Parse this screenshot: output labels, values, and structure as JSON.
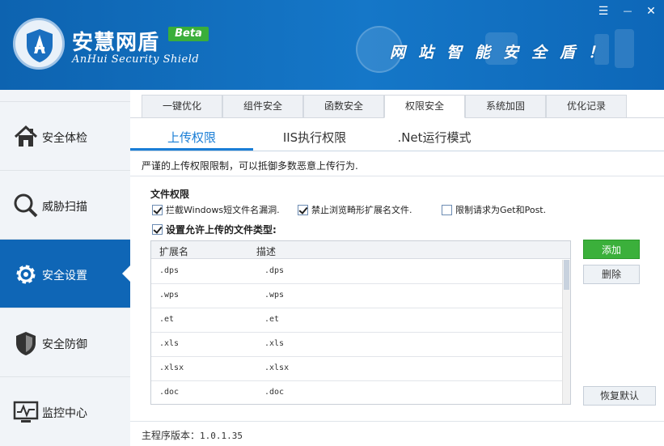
{
  "app": {
    "title": "安慧网盾",
    "badge": "Beta",
    "subtitle": "AnHui Security Shield",
    "slogan": "网站智能安全盾！",
    "brand_color": "#1571c2"
  },
  "window_controls": {
    "menu": "☰",
    "minimize": "—",
    "close": "✕"
  },
  "sidebar": {
    "items": [
      {
        "label": "安全体检",
        "icon": "home-icon"
      },
      {
        "label": "威胁扫描",
        "icon": "magnifier-icon"
      },
      {
        "label": "安全设置",
        "icon": "gear-icon",
        "active": true
      },
      {
        "label": "安全防御",
        "icon": "shield-icon"
      },
      {
        "label": "监控中心",
        "icon": "monitor-icon"
      }
    ]
  },
  "tabs": [
    {
      "label": "一键优化"
    },
    {
      "label": "组件安全"
    },
    {
      "label": "函数安全"
    },
    {
      "label": "权限安全",
      "active": true
    },
    {
      "label": "系统加固"
    },
    {
      "label": "优化记录"
    }
  ],
  "subtabs": [
    {
      "label": "上传权限",
      "active": true
    },
    {
      "label": "IIS执行权限"
    },
    {
      "label": ".Net运行模式"
    }
  ],
  "description": "严谨的上传权限限制，可以抵御多数恶意上传行为.",
  "file_permission": {
    "title": "文件权限",
    "options": [
      {
        "label": "拦截Windows短文件名漏洞.",
        "checked": true
      },
      {
        "label": "禁止浏览畸形扩展名文件.",
        "checked": true
      },
      {
        "label": "限制请求为Get和Post.",
        "checked": false
      }
    ],
    "allow_upload": {
      "label": "设置允许上传的文件类型:",
      "checked": true
    }
  },
  "table": {
    "headers": {
      "ext": "扩展名",
      "desc": "描述"
    },
    "rows": [
      {
        "ext": ".dps",
        "desc": ".dps"
      },
      {
        "ext": ".wps",
        "desc": ".wps"
      },
      {
        "ext": ".et",
        "desc": ".et"
      },
      {
        "ext": ".xls",
        "desc": ".xls"
      },
      {
        "ext": ".xlsx",
        "desc": ".xlsx"
      },
      {
        "ext": ".doc",
        "desc": ".doc"
      }
    ]
  },
  "buttons": {
    "add": "添加",
    "delete": "删除",
    "restore": "恢复默认"
  },
  "footer": {
    "label": "主程序版本：",
    "version": "1.0.1.35"
  }
}
